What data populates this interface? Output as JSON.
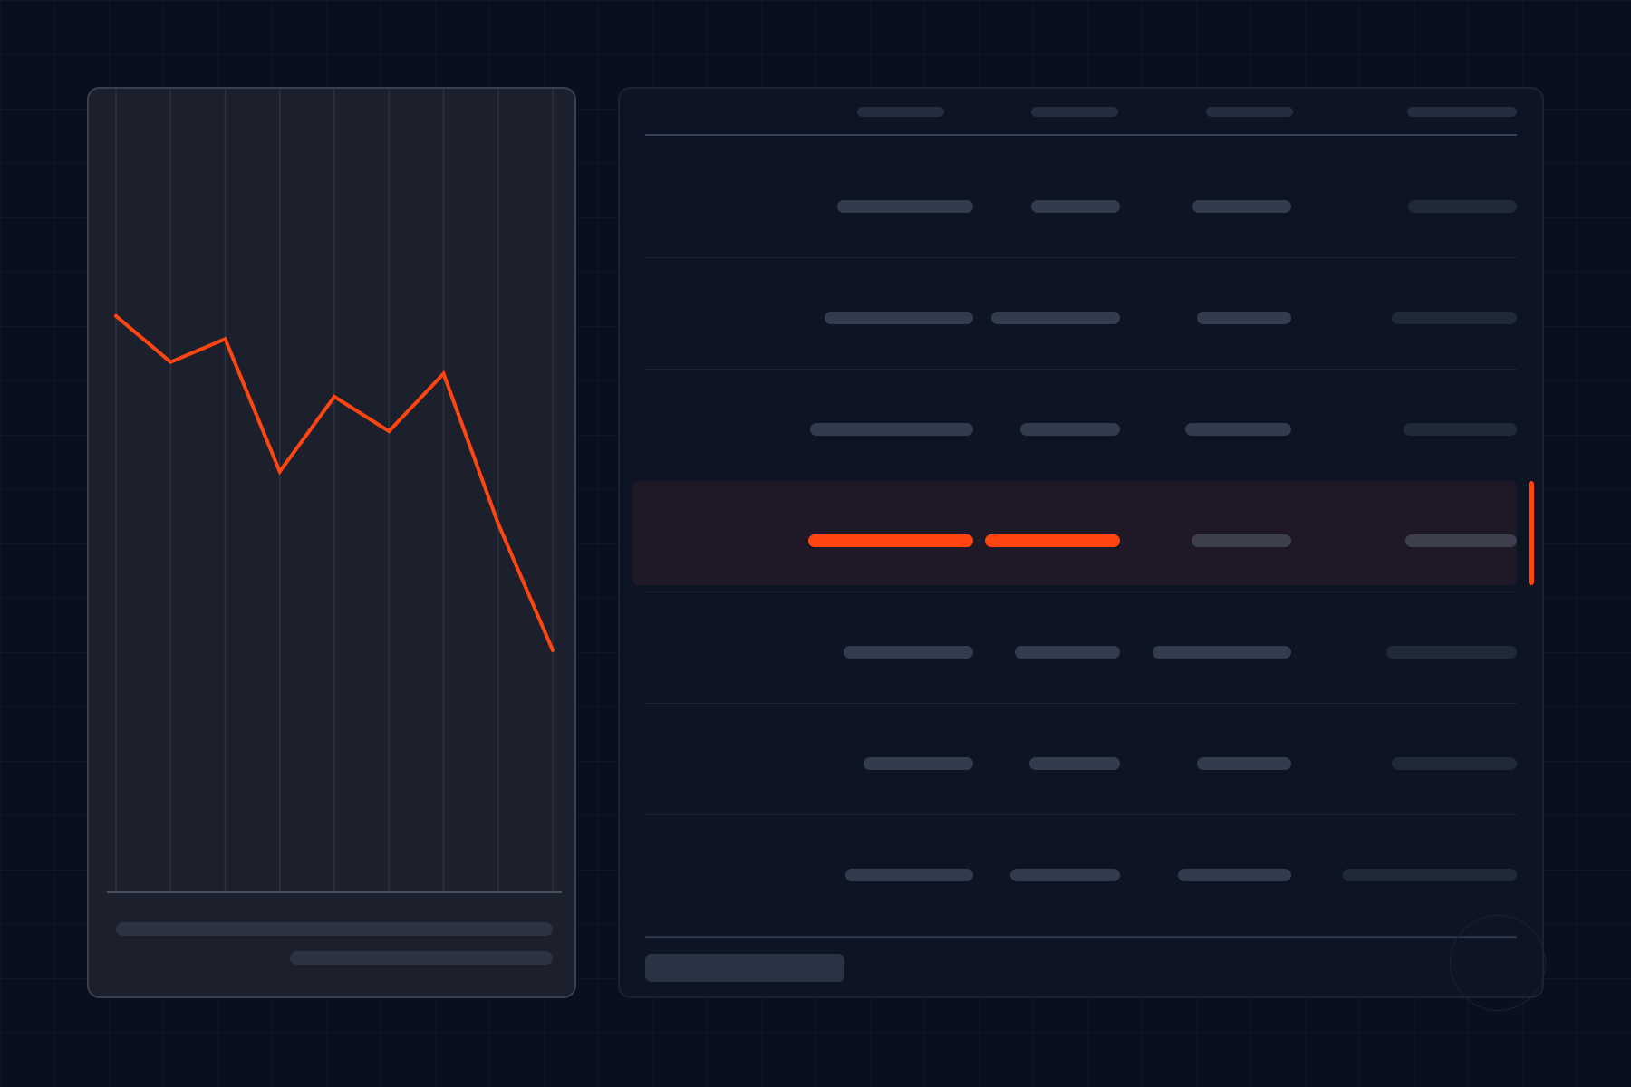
{
  "chart_data": {
    "type": "line",
    "x": [
      1,
      2,
      3,
      4,
      5,
      6,
      7,
      8,
      9
    ],
    "values": [
      100,
      92,
      96,
      73,
      86,
      80,
      90,
      64,
      42
    ],
    "ylim": [
      0,
      130
    ],
    "grid": "vertical",
    "title": "",
    "xlabel": "",
    "ylabel": ""
  },
  "colors": {
    "accent": "#ff4510",
    "background": "#0a0f1e",
    "chart_card": "#1c1f2c",
    "table_card": "#0d1423",
    "selected_row": "#1e1827",
    "placeholder_bar": "#333c4d"
  },
  "table": {
    "selected_row": 4,
    "row_count": 7,
    "column_count": 4
  }
}
